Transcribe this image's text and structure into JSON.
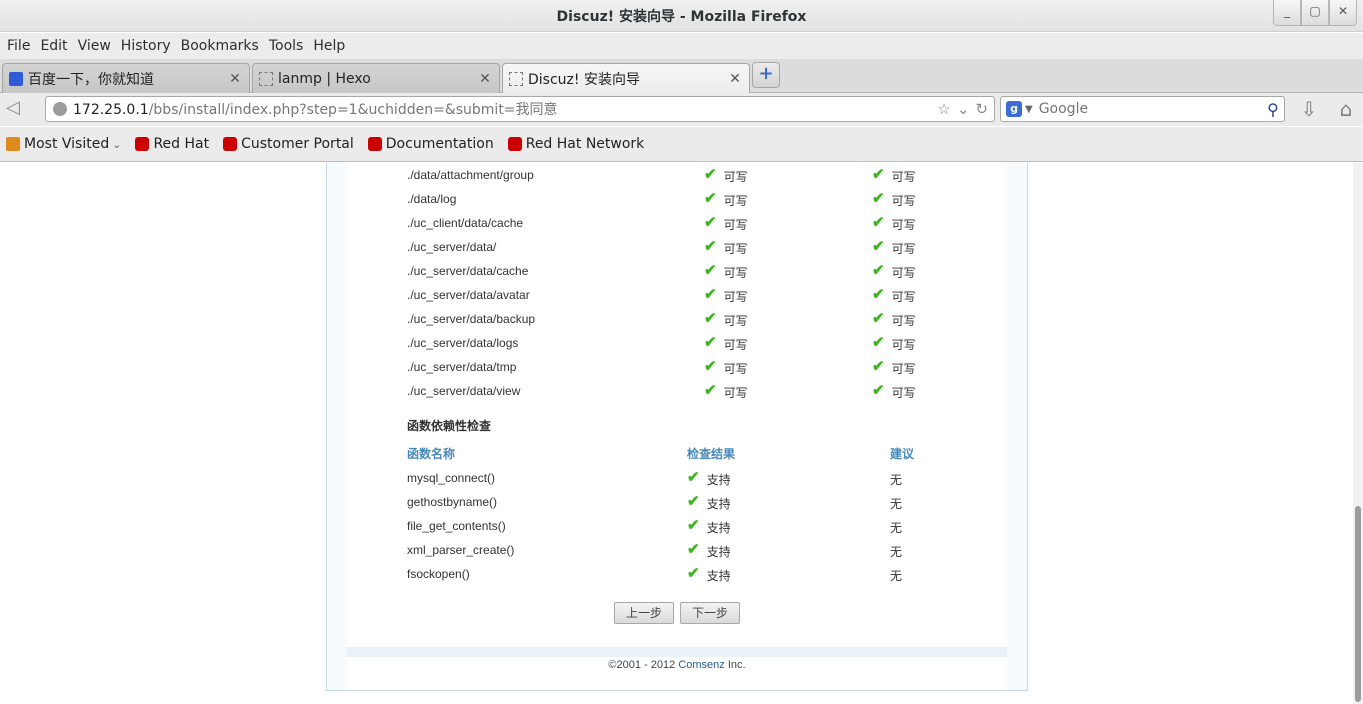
{
  "window": {
    "title": "Discuz! 安装向导 - Mozilla Firefox",
    "controls": [
      "_",
      "▢",
      "✕"
    ]
  },
  "menu": [
    "File",
    "Edit",
    "View",
    "History",
    "Bookmarks",
    "Tools",
    "Help"
  ],
  "tabs": [
    {
      "label": "百度一下，你就知道",
      "favicon": "baidu-paw-icon",
      "active": false
    },
    {
      "label": "lanmp | Hexo",
      "favicon": "blank-page-icon",
      "active": false
    },
    {
      "label": "Discuz! 安装向导",
      "favicon": "blank-page-icon",
      "active": true
    }
  ],
  "newtab_label": "+",
  "address": {
    "host": "172.25.0.1",
    "path": "/bbs/install/index.php?step=1&uchidden=&submit=我同意"
  },
  "search": {
    "engine": "g",
    "placeholder": "Google"
  },
  "bookmarks": [
    "Most Visited",
    "Red Hat",
    "Customer Portal",
    "Documentation",
    "Red Hat Network"
  ],
  "dirs": [
    {
      "path": "./data/attachment/group",
      "status1": "可写",
      "status2": "可写"
    },
    {
      "path": "./data/log",
      "status1": "可写",
      "status2": "可写"
    },
    {
      "path": "./uc_client/data/cache",
      "status1": "可写",
      "status2": "可写"
    },
    {
      "path": "./uc_server/data/",
      "status1": "可写",
      "status2": "可写"
    },
    {
      "path": "./uc_server/data/cache",
      "status1": "可写",
      "status2": "可写"
    },
    {
      "path": "./uc_server/data/avatar",
      "status1": "可写",
      "status2": "可写"
    },
    {
      "path": "./uc_server/data/backup",
      "status1": "可写",
      "status2": "可写"
    },
    {
      "path": "./uc_server/data/logs",
      "status1": "可写",
      "status2": "可写"
    },
    {
      "path": "./uc_server/data/tmp",
      "status1": "可写",
      "status2": "可写"
    },
    {
      "path": "./uc_server/data/view",
      "status1": "可写",
      "status2": "可写"
    }
  ],
  "functions": {
    "title": "函数依赖性检查",
    "headers": {
      "name": "函数名称",
      "result": "检查结果",
      "advice": "建议"
    },
    "rows": [
      {
        "name": "mysql_connect()",
        "result": "支持",
        "advice": "无"
      },
      {
        "name": "gethostbyname()",
        "result": "支持",
        "advice": "无"
      },
      {
        "name": "file_get_contents()",
        "result": "支持",
        "advice": "无"
      },
      {
        "name": "xml_parser_create()",
        "result": "支持",
        "advice": "无"
      },
      {
        "name": "fsockopen()",
        "result": "支持",
        "advice": "无"
      }
    ]
  },
  "buttons": {
    "prev": "上一步",
    "next": "下一步"
  },
  "footer": {
    "prefix": "©2001 - 2012",
    "link": "Comsenz",
    "suffix": "Inc."
  }
}
